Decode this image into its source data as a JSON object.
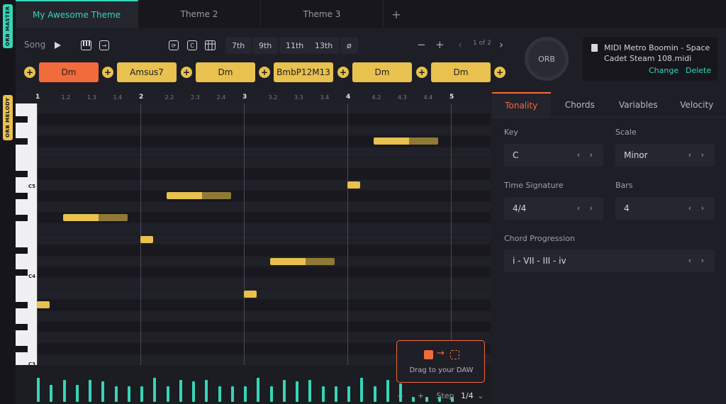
{
  "side_tags": {
    "master": "ORB MASTER",
    "melody": "ORB MELODY"
  },
  "tabs": [
    {
      "label": "My Awesome Theme",
      "active": true
    },
    {
      "label": "Theme 2",
      "active": false
    },
    {
      "label": "Theme 3",
      "active": false
    }
  ],
  "tab_add": "+",
  "toolbar": {
    "song_label": "Song",
    "play_icon": "play-icon",
    "piano_icon": "piano-icon",
    "export_icon": "export-icon",
    "loop_icon": "loop-icon",
    "chord_c_icon": "chord-c-icon",
    "grid_icon": "grid-icon",
    "extensions": [
      "7th",
      "9th",
      "11th",
      "13th",
      "ø"
    ],
    "zoom_out": "−",
    "zoom_in": "+",
    "pager_prev": "‹",
    "pager_text": "1 of 2",
    "pager_next": "›"
  },
  "chords": [
    {
      "label": "Dm",
      "active": true
    },
    {
      "label": "Amsus7",
      "active": false
    },
    {
      "label": "Dm",
      "active": false
    },
    {
      "label": "BmbP12M13",
      "active": false
    },
    {
      "label": "Dm",
      "active": false
    },
    {
      "label": "Dm",
      "active": false
    }
  ],
  "chord_add": "+",
  "orb_label": "ORB",
  "midi": {
    "filename": "MIDI Metro Boomin - Space Cadet Steam 108.midi",
    "change": "Change",
    "delete": "Delete"
  },
  "ruler": [
    "1",
    "1.2",
    "1.3",
    "1.4",
    "2",
    "2.2",
    "2.3",
    "2.4",
    "3",
    "3.2",
    "3.3",
    "3.4",
    "4",
    "4.2",
    "4.3",
    "4.4",
    "5"
  ],
  "keys": {
    "c5": "C5",
    "c4": "C4",
    "c3": "C3"
  },
  "notes": [
    {
      "row": 18,
      "start": 1.0,
      "length": 0.125
    },
    {
      "row": 10,
      "start": 1.25,
      "length": 0.625
    },
    {
      "row": 12,
      "start": 2.0,
      "length": 0.125
    },
    {
      "row": 8,
      "start": 2.25,
      "length": 0.625
    },
    {
      "row": 17,
      "start": 3.0,
      "length": 0.125
    },
    {
      "row": 14,
      "start": 3.25,
      "length": 0.625
    },
    {
      "row": 7,
      "start": 4.0,
      "length": 0.125
    },
    {
      "row": 3,
      "start": 4.25,
      "length": 0.625
    }
  ],
  "note_colors": {
    "bright": "#e8c14e",
    "dim": "#8f7a35"
  },
  "velocities": [
    0.7,
    0.5,
    0.65,
    0.5,
    0.65,
    0.6,
    0.45,
    0.45,
    0.45,
    0.7,
    0.45,
    0.65,
    0.6,
    0.65,
    0.45,
    0.45,
    0.45,
    0.7,
    0.45,
    0.65,
    0.6,
    0.65,
    0.45,
    0.45,
    0.45,
    0.7,
    0.45,
    0.65,
    0.55,
    0.15,
    0.15,
    0.15,
    0.15
  ],
  "accent": "#35d6b8",
  "step": {
    "minus": "−",
    "plus": "+",
    "label": "Step",
    "value": "1/4",
    "chevron": "⌄"
  },
  "drag": {
    "text": "Drag to your DAW",
    "arrow": "→"
  },
  "panel": {
    "tabs": [
      {
        "label": "Tonality",
        "active": true
      },
      {
        "label": "Chords",
        "active": false
      },
      {
        "label": "Variables",
        "active": false
      },
      {
        "label": "Velocity",
        "active": false
      }
    ],
    "key_label": "Key",
    "key_value": "C",
    "scale_label": "Scale",
    "scale_value": "Minor",
    "time_sig_label": "Time Signature",
    "time_sig_value": "4/4",
    "bars_label": "Bars",
    "bars_value": "4",
    "progression_label": "Chord Progression",
    "progression_value": "i - VII - III - iv",
    "arrows": "‹ ›"
  }
}
